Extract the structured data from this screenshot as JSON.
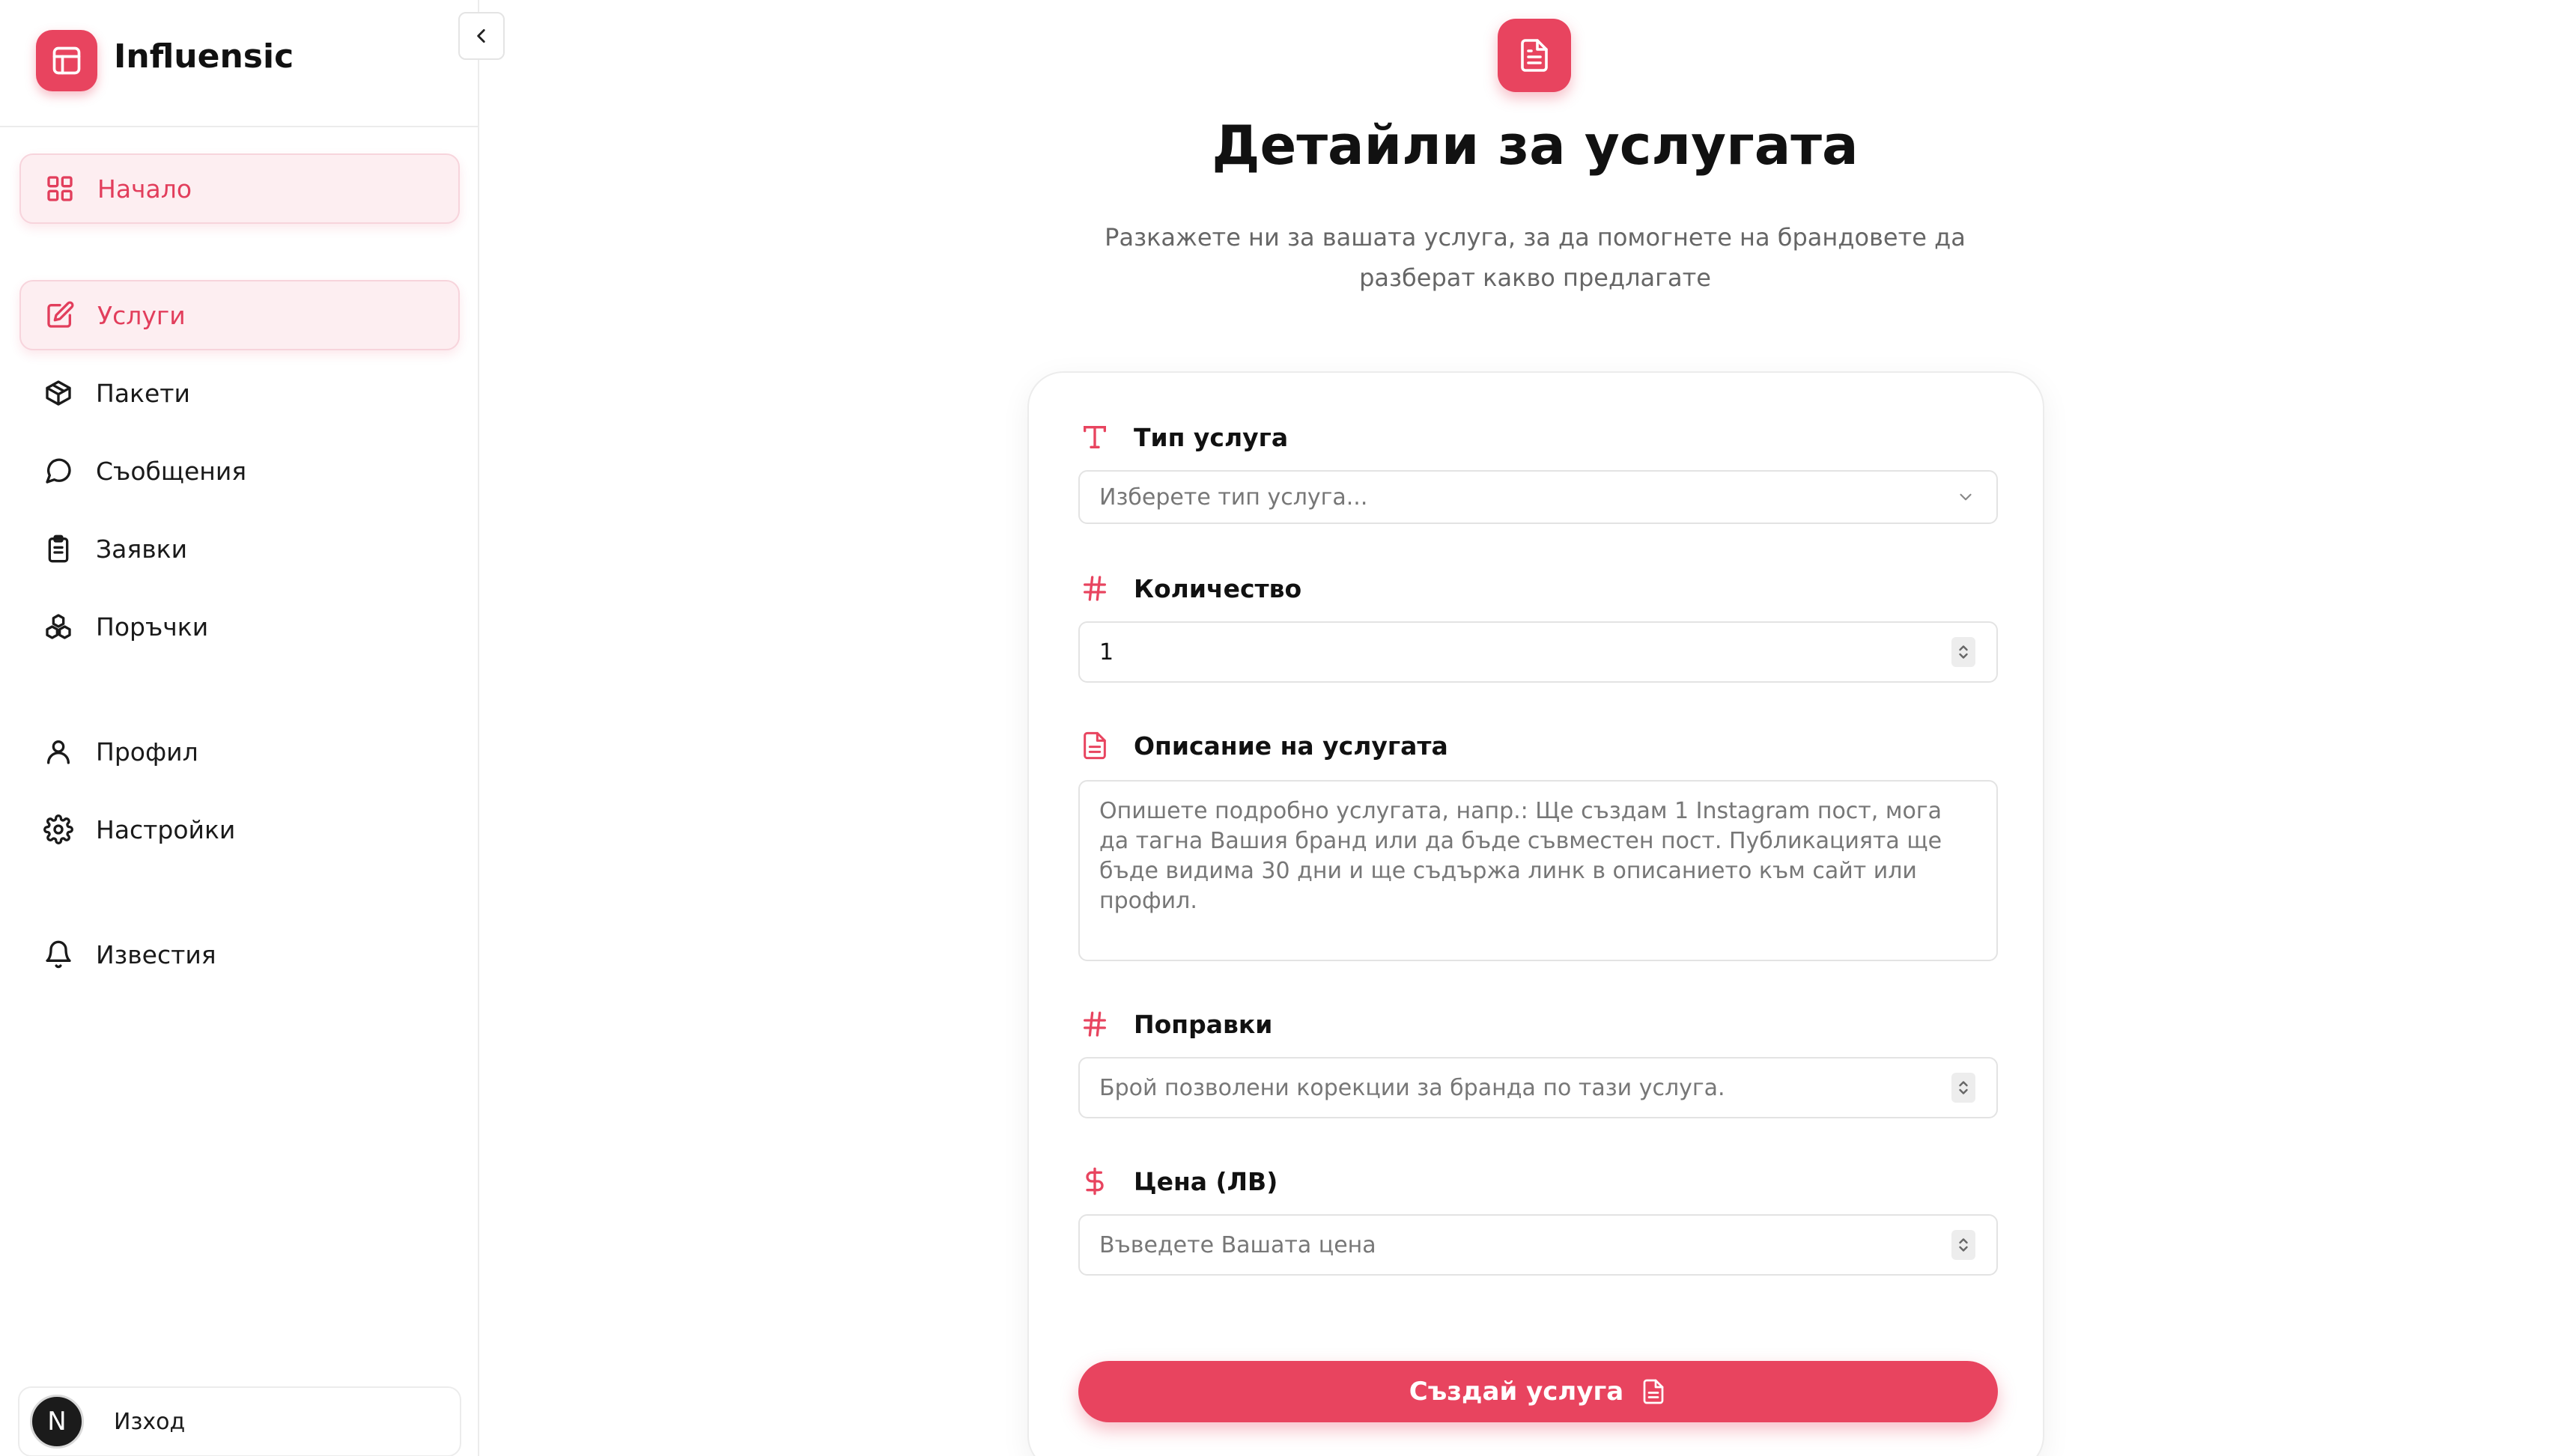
{
  "brand": {
    "name": "Influensic"
  },
  "sidebar": {
    "items": [
      {
        "label": "Начало",
        "icon": "grid-icon",
        "active": true
      },
      {
        "label": "Услуги",
        "icon": "edit-icon",
        "active": true
      },
      {
        "label": "Пакети",
        "icon": "package-icon",
        "active": false
      },
      {
        "label": "Съобщения",
        "icon": "chat-icon",
        "active": false
      },
      {
        "label": "Заявки",
        "icon": "clipboard-icon",
        "active": false
      },
      {
        "label": "Поръчки",
        "icon": "boxes-icon",
        "active": false
      },
      {
        "label": "Профил",
        "icon": "user-icon",
        "active": false
      },
      {
        "label": "Настройки",
        "icon": "gear-icon",
        "active": false
      },
      {
        "label": "Известия",
        "icon": "bell-icon",
        "active": false
      }
    ],
    "logout": {
      "avatar_letter": "N",
      "label": "Изход"
    }
  },
  "page": {
    "title": "Детайли за услугата",
    "subtitle": "Разкажете ни за вашата услуга, за да помогнете на брандовете да разберат какво предлагате"
  },
  "form": {
    "service_type": {
      "label": "Тип услуга",
      "placeholder": "Изберете тип услуга..."
    },
    "quantity": {
      "label": "Количество",
      "value": "1"
    },
    "description": {
      "label": "Описание на услугата",
      "placeholder": "Опишете подробно услугата, напр.: Ще създам 1 Instagram пост, мога да тагна Вашия бранд или да бъде съвместен пост. Публикацията ще бъде видима 30 дни и ще съдържа линк в описанието към сайт или профил."
    },
    "revisions": {
      "label": "Поправки",
      "placeholder": "Брой позволени корекции за бранда по тази услуга."
    },
    "price": {
      "label": "Цена (ЛВ)",
      "placeholder": "Въведете Вашата цена"
    },
    "submit_label": "Създай услуга"
  },
  "colors": {
    "accent": "#e8445f",
    "accent_light": "#fdeef1"
  }
}
